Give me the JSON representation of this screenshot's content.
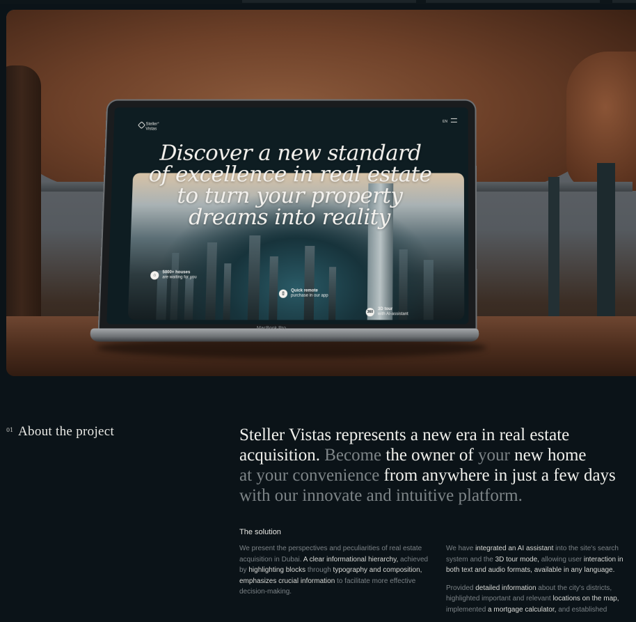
{
  "hero": {
    "laptop_screen": {
      "brand_name": "Steller°\nVistas",
      "language": "EN",
      "headline_lines": [
        "Discover a new standard",
        "of excellence in real estate",
        "to turn your property",
        "dreams into reality"
      ],
      "features": [
        {
          "icon": "home-icon",
          "title": "5000+ houses",
          "subtitle": "are waiting for you"
        },
        {
          "icon": "phone-icon",
          "title": "Quick remote",
          "subtitle": "purchase in our app"
        },
        {
          "icon": "360-icon",
          "title": "3D tour",
          "subtitle": "with AI-assistant",
          "icon_text": "360"
        }
      ]
    },
    "device_label": "MacBook Pro"
  },
  "about": {
    "number": "01",
    "title": "About the project",
    "lead_segments": [
      [
        {
          "t": "Steller Vistas represents a new era in real estate",
          "dim": false
        }
      ],
      [
        {
          "t": "acquisition. ",
          "dim": false
        },
        {
          "t": "Become",
          "dim": true
        },
        {
          "t": " the owner of ",
          "dim": false
        },
        {
          "t": "your",
          "dim": true
        },
        {
          "t": " new home",
          "dim": false
        }
      ],
      [
        {
          "t": "at your convenience",
          "dim": true
        },
        {
          "t": " from anywhere in just a few days",
          "dim": false
        }
      ],
      [
        {
          "t": "with our innovate and intuitive platform.",
          "dim": true
        }
      ]
    ],
    "solution_title": "The solution",
    "left_column": [
      [
        {
          "t": "We present the perspectives and peculiarities of real estate acquisition in Dubai. ",
          "hl": false
        },
        {
          "t": "A clear informational hierarchy,",
          "hl": true
        },
        {
          "t": " achieved by ",
          "hl": false
        },
        {
          "t": "highlighting blocks",
          "hl": true
        },
        {
          "t": " through ",
          "hl": false
        },
        {
          "t": "typography and composition,",
          "hl": true
        },
        {
          "t": " emphasizes crucial information",
          "hl": true
        },
        {
          "t": " to facilitate more effective decision-making.",
          "hl": false
        }
      ]
    ],
    "right_column": [
      [
        {
          "t": "We have ",
          "hl": false
        },
        {
          "t": "integrated an AI assistant",
          "hl": true
        },
        {
          "t": " into the site's search system and the ",
          "hl": false
        },
        {
          "t": "3D tour mode,",
          "hl": true
        },
        {
          "t": " allowing user ",
          "hl": false
        },
        {
          "t": "interaction in both text and audio formats, available in any language.",
          "hl": true
        }
      ],
      [
        {
          "t": "Provided ",
          "hl": false
        },
        {
          "t": "detailed information",
          "hl": true
        },
        {
          "t": " about the city's districts, highlighted important and relevant ",
          "hl": false
        },
        {
          "t": "locations on the map,",
          "hl": true
        },
        {
          "t": " implemented ",
          "hl": false
        },
        {
          "t": "a mortgage calculator,",
          "hl": true
        },
        {
          "t": " and established",
          "hl": false
        }
      ]
    ]
  }
}
